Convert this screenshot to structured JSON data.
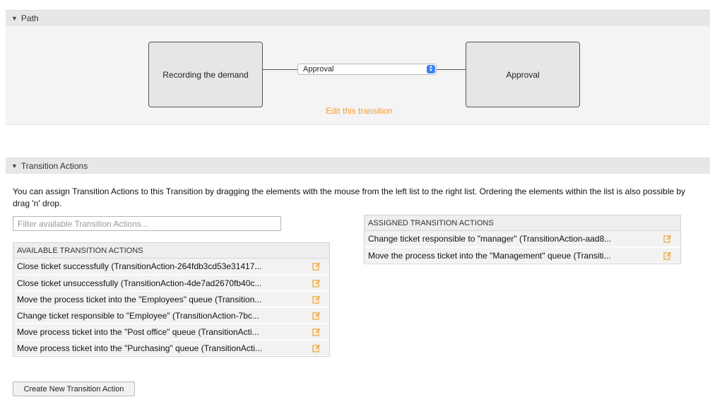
{
  "path": {
    "header": "Path",
    "start_activity": "Recording the demand",
    "end_activity": "Approval",
    "transition_selected": "Approval",
    "edit_link": "Edit this transition"
  },
  "transition_actions": {
    "header": "Transition Actions",
    "description": "You can assign Transition Actions to this Transition by dragging the elements with the mouse from the left list to the right list. Ordering the elements within the list is also possible by drag 'n' drop.",
    "filter_placeholder": "Filter available Transition Actions...",
    "available": {
      "header": "AVAILABLE TRANSITION ACTIONS",
      "items": [
        "Close ticket successfully (TransitionAction-264fdb3cd53e31417...",
        "Close ticket unsuccessfully (TransitionAction-4de7ad2670fb40c...",
        "Move the process ticket into the \"Employees\" queue (Transition...",
        "Change ticket responsible to \"Employee\" (TransitionAction-7bc...",
        "Move process ticket into the \"Post office\" queue (TransitionActi...",
        "Move process ticket into the \"Purchasing\" queue (TransitionActi..."
      ]
    },
    "assigned": {
      "header": "ASSIGNED TRANSITION ACTIONS",
      "items": [
        "Change ticket responsible to \"manager\" (TransitionAction-aad8...",
        "Move the process ticket into the \"Management\" queue (Transiti..."
      ]
    },
    "create_button": "Create New Transition Action"
  },
  "icons": {
    "collapse": "triangle-down-icon",
    "edit": "edit-pencil-icon",
    "select_arrows": "updown-arrows-icon"
  },
  "colors": {
    "accent_link": "#f39c33",
    "edit_icon": "#f0a73c",
    "select_arrow": "#3b82f6"
  }
}
